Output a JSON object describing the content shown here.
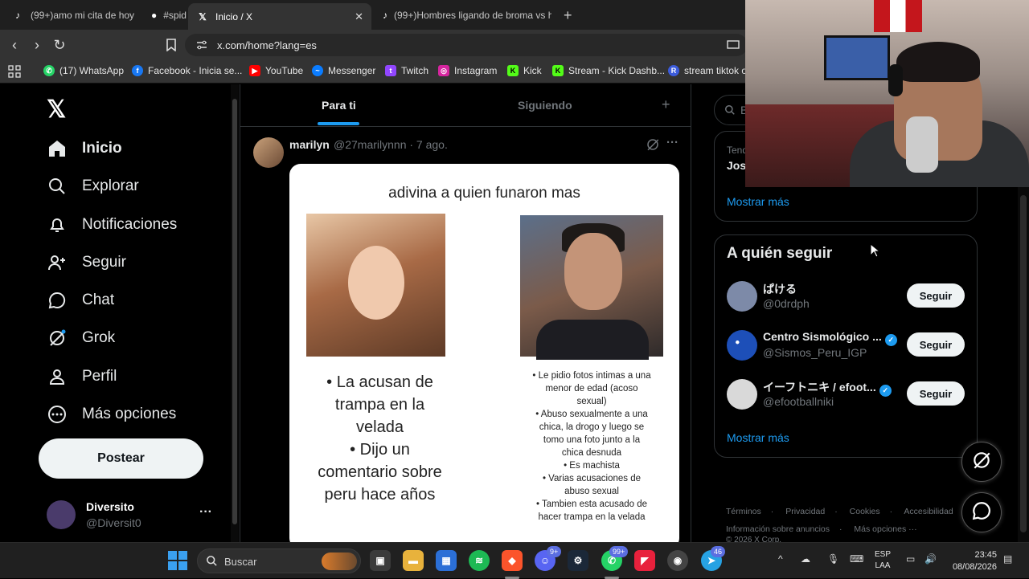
{
  "browser": {
    "tabs": [
      {
        "title": "(99+)amo mi cita de hoy",
        "favicon": "tiktok-icon",
        "active": false
      },
      {
        "title": "#spid",
        "favicon": "loading-icon",
        "active": false
      },
      {
        "title": "Inicio / X",
        "favicon": "x-icon",
        "active": true
      },
      {
        "title": "(99+)Hombres ligando de broma vs h",
        "favicon": "tiktok-icon",
        "active": false
      }
    ],
    "url": "x.com/home?lang=es",
    "bookmarks": [
      {
        "label": "(17) WhatsApp",
        "icon": "whatsapp-icon",
        "color": "#25d366"
      },
      {
        "label": "Facebook - Inicia se...",
        "icon": "facebook-icon",
        "color": "#1877f2"
      },
      {
        "label": "YouTube",
        "icon": "youtube-icon",
        "color": "#ff0000"
      },
      {
        "label": "Messenger",
        "icon": "messenger-icon",
        "color": "#0a7cff"
      },
      {
        "label": "Twitch",
        "icon": "twitch-icon",
        "color": "#9146ff"
      },
      {
        "label": "Instagram",
        "icon": "instagram-icon",
        "color": "#d6249f"
      },
      {
        "label": "Kick",
        "icon": "kick-icon",
        "color": "#53fc18"
      },
      {
        "label": "Stream - Kick Dashb...",
        "icon": "kick-icon",
        "color": "#53fc18"
      },
      {
        "label": "stream tiktok o",
        "icon": "r-icon",
        "color": "#3b5bdb"
      }
    ]
  },
  "nav": {
    "items": [
      {
        "label": "Inicio",
        "icon": "home-icon"
      },
      {
        "label": "Explorar",
        "icon": "search-icon"
      },
      {
        "label": "Notificaciones",
        "icon": "bell-icon"
      },
      {
        "label": "Seguir",
        "icon": "person-add-icon"
      },
      {
        "label": "Chat",
        "icon": "chat-icon"
      },
      {
        "label": "Grok",
        "icon": "grok-icon"
      },
      {
        "label": "Perfil",
        "icon": "person-icon"
      },
      {
        "label": "Más opciones",
        "icon": "more-circle-icon"
      }
    ],
    "post_button": "Postear",
    "account": {
      "name": "Diversito",
      "handle": "@Diversit0"
    }
  },
  "timeline": {
    "tabs": [
      "Para ti",
      "Siguiendo"
    ],
    "post": {
      "author": "marilyn",
      "meta": "@27marilynnn · 7 ago.",
      "image": {
        "title": "adivina a quien funaron mas",
        "left_lines": [
          "• La acusan de",
          "trampa en la",
          "velada",
          "• Dijo un",
          "comentario sobre",
          "peru hace años"
        ],
        "right_lines": [
          "• Le pidio fotos intimas a una",
          "menor de edad (acoso",
          "sexual)",
          "• Abuso sexualmente a una",
          "chica, la drogo y luego se",
          "tomo una foto junto a la",
          "chica desnuda",
          "• Es machista",
          "• Varias acusaciones de",
          "abuso sexual",
          "• Tambien esta acusado de",
          "hacer trampa en la velada"
        ]
      }
    }
  },
  "sidebar": {
    "search_placeholder": "B",
    "trend_category": "Tend",
    "trend_name": "Jos",
    "trends_more": "Mostrar más",
    "follow": {
      "title": "A quién seguir",
      "button_label": "Seguir",
      "suggestions": [
        {
          "name": "ぱける",
          "handle": "@0drdph",
          "verified": false,
          "color": "#7d8aa8"
        },
        {
          "name": "Centro Sismológico ...",
          "handle": "@Sismos_Peru_IGP",
          "verified": true,
          "color": "#1d4fb8"
        },
        {
          "name": "イーフトニキ / efoot...",
          "handle": "@efootballniki",
          "verified": true,
          "color": "#d9d9d9"
        }
      ],
      "more": "Mostrar más"
    },
    "footer": [
      "Términos",
      "Privacidad",
      "Cookies",
      "Accesibilidad",
      "Información sobre anuncios",
      "Más opciones ···"
    ],
    "copyright": "© 2026 X Corp."
  },
  "taskbar": {
    "search_label": "Buscar",
    "badges": {
      "discord": "9+",
      "whatsapp": "99+",
      "telegram": "46"
    },
    "language": [
      "ESP",
      "LAA"
    ],
    "time": "23:45",
    "date": "08/08/2026"
  }
}
